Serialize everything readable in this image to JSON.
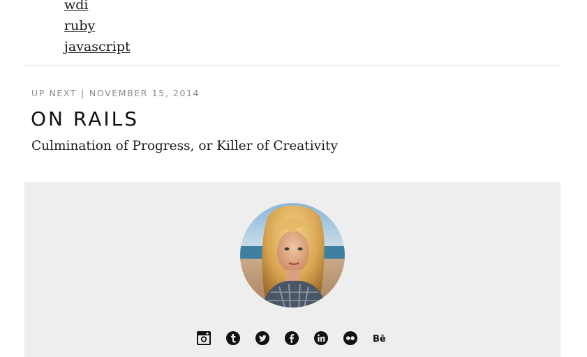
{
  "tags": [
    "wdi",
    "ruby",
    "javascript"
  ],
  "up_next": {
    "label": "UP NEXT",
    "separator": "|",
    "date": "NOVEMBER 15, 2014",
    "title": "ON RAILS",
    "subtitle": "Culmination of Progress, or Killer of Creativity"
  },
  "footer": {
    "social_icons": [
      "instagram-icon",
      "tumblr-icon",
      "twitter-icon",
      "facebook-icon",
      "linkedin-icon",
      "flickr-icon",
      "behance-icon"
    ],
    "behance_text": "Bē"
  },
  "colors": {
    "footer_bg": "#eeeeee",
    "meta_text": "#8a8a8a",
    "icon": "#111111"
  }
}
